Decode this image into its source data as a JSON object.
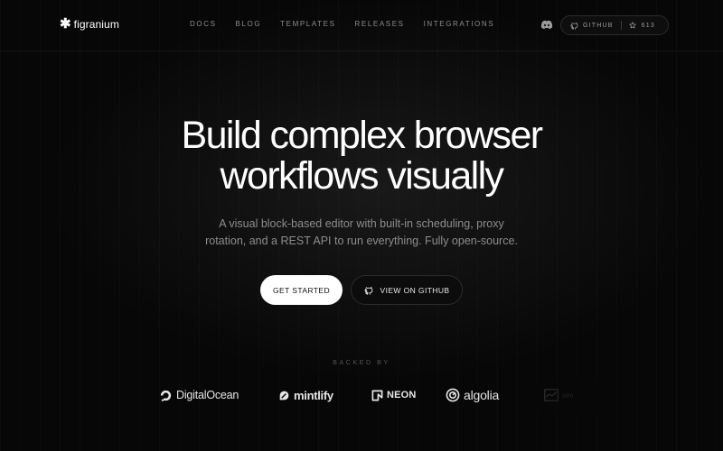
{
  "brand": {
    "name": "figranium",
    "logo_icon": "asterisk-icon",
    "text_color": "#ffffff"
  },
  "nav": {
    "links": [
      "DOCS",
      "BLOG",
      "TEMPLATES",
      "RELEASES",
      "INTEGRATIONS"
    ],
    "discord_icon": "discord-icon",
    "github_label": "GITHUB",
    "star_count": "613"
  },
  "hero": {
    "title_line1": "Build complex browser",
    "title_line2": "workflows visually",
    "subtitle_line1": "A visual block-based editor with built-in scheduling, proxy",
    "subtitle_line2": "rotation, and a REST API to run everything. Fully open-source.",
    "primary_cta": "GET STARTED",
    "secondary_cta": "VIEW ON GITHUB"
  },
  "backed": {
    "label": "BACKED BY",
    "sponsors": [
      "DigitalOcean",
      "mintlify",
      "NEON",
      "algolia",
      "sim"
    ]
  },
  "colors": {
    "background": "#070707",
    "muted_text": "#8d8d8d",
    "primary_button": "#ffffff"
  }
}
